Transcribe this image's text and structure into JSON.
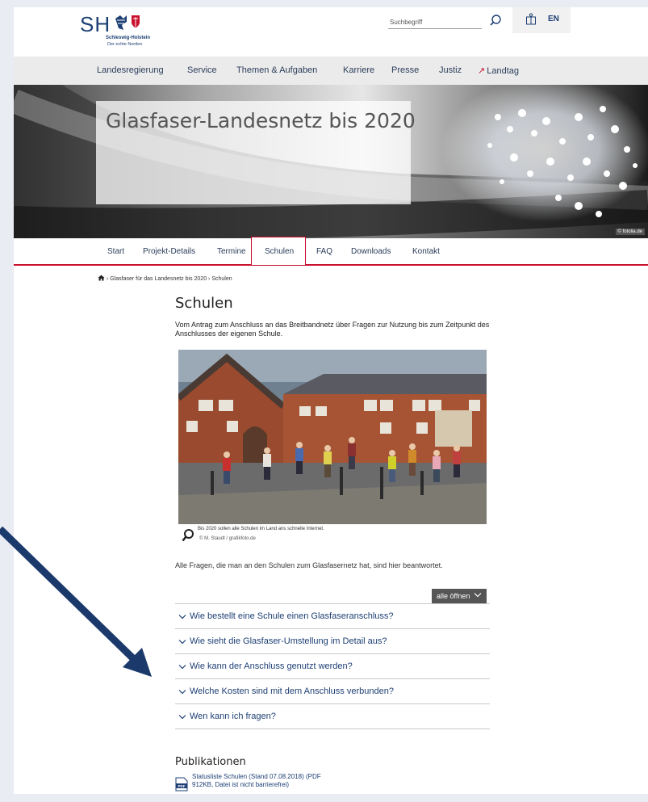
{
  "header": {
    "logo_sh": "SH",
    "logo_name": "Schleswig-Holstein",
    "logo_tag": "Der echte Norden",
    "search_placeholder": "Suchbegriff",
    "language": "EN"
  },
  "nav": {
    "items": [
      "Landesregierung",
      "Service",
      "Themen & Aufgaben",
      "Karriere",
      "Presse",
      "Justiz",
      "Landtag"
    ]
  },
  "hero": {
    "title": "Glasfaser-Landesnetz bis 2020",
    "credit": "© fotolia.de"
  },
  "subnav": {
    "items": [
      "Start",
      "Projekt-Details",
      "Termine",
      "Schulen",
      "FAQ",
      "Downloads",
      "Kontakt"
    ],
    "active": "Schulen"
  },
  "breadcrumb": {
    "items": [
      "Glasfaser für das Landesnetz bis 2020",
      "Schulen"
    ]
  },
  "main": {
    "title": "Schulen",
    "intro": "Vom Antrag zum Anschluss an das Breitbandnetz über Fragen zur Nutzung bis zum Zeitpunkt des Anschlusses der eigenen Schule.",
    "photo_caption": "Bis 2020 sollen alle Schulen im Land ans schnelle Internet.",
    "photo_copyright": "© M. Staudt / grafikfoto.de",
    "answer_text": "Alle Fragen, die man an den Schulen zum Glasfasernetz hat, sind hier beantwortet.",
    "all_open_label": "alle öffnen",
    "faq": [
      "Wie bestellt eine Schule einen Glasfaseranschluss?",
      "Wie sieht die Glasfaser-Umstellung im Detail aus?",
      "Wie kann der Anschluss genutzt werden?",
      "Welche Kosten sind mit dem Anschluss verbunden?",
      "Wen kann ich fragen?"
    ]
  },
  "publications": {
    "title": "Publikationen",
    "items": [
      {
        "label": "Statusliste Schulen (Stand 07.08.2018) (PDF 912KB, Datei ist nicht barrierefrei)",
        "icon": "PDF"
      }
    ]
  },
  "colors": {
    "brand_blue": "#1d3f74",
    "accent_red": "#c8102e",
    "pointer_arrow": "#1b3a6b"
  }
}
